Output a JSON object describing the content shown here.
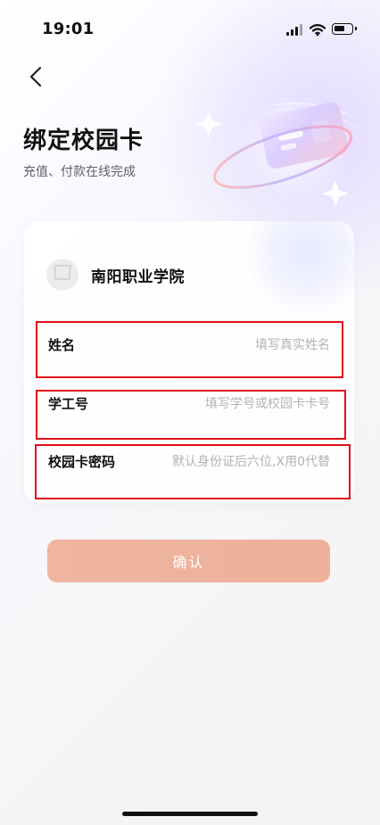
{
  "status": {
    "time": "19:01"
  },
  "header": {
    "title": "绑定校园卡",
    "subtitle": "充值、付款在线完成"
  },
  "school": {
    "name": "南阳职业学院"
  },
  "form": {
    "name": {
      "label": "姓名",
      "placeholder": "填写真实姓名",
      "value": ""
    },
    "student_id": {
      "label": "学工号",
      "placeholder": "填写学号或校园卡卡号",
      "value": ""
    },
    "card_password": {
      "label": "校园卡密码",
      "placeholder": "默认身份证后六位,X用0代替",
      "value": ""
    }
  },
  "actions": {
    "confirm_label": "确认"
  },
  "colors": {
    "highlight": "#e0101a",
    "confirm_button": "#efb59e"
  }
}
